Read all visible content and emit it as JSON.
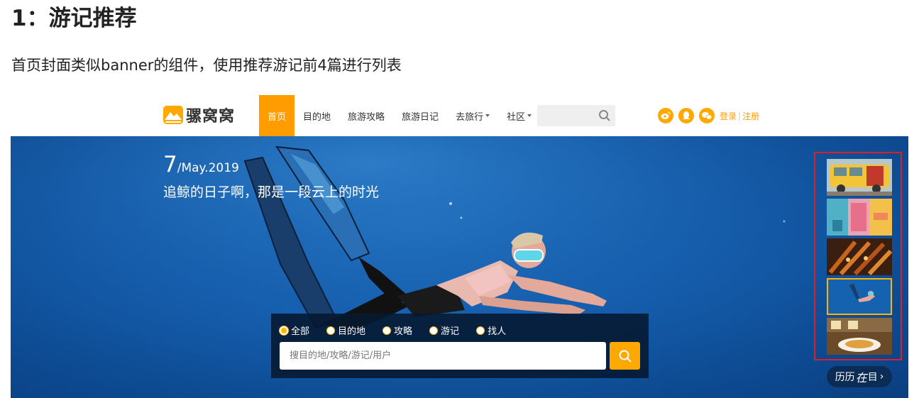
{
  "section": {
    "title": "1：游记推荐",
    "description": "首页封面类似banner的组件，使用推荐游记前4篇进行列表"
  },
  "header": {
    "logo_text": "骡窝窝",
    "nav": [
      {
        "label": "首页",
        "active": true
      },
      {
        "label": "目的地"
      },
      {
        "label": "旅游攻略"
      },
      {
        "label": "旅游日记"
      },
      {
        "label": "去旅行",
        "dropdown": true
      },
      {
        "label": "社区",
        "dropdown": true
      }
    ],
    "search_placeholder": "",
    "social_icons": [
      "weibo-icon",
      "qq-icon",
      "wechat-icon"
    ],
    "login_label": "登录",
    "separator": "|",
    "register_label": "注册",
    "accent_color": "#ff9d00"
  },
  "banner": {
    "day": "7",
    "date_rest": "/May.2019",
    "caption": "追鲸的日子啊，那是一段云上的时光",
    "thumbnails": [
      {
        "name": "thumb-yellow-van"
      },
      {
        "name": "thumb-colorful-street"
      },
      {
        "name": "thumb-skewers-food"
      },
      {
        "name": "thumb-diver",
        "active": true
      },
      {
        "name": "thumb-restaurant-meal"
      }
    ],
    "history_button": {
      "part1": "历历",
      "part2": "在",
      "part3": "目",
      "arrow": "›"
    }
  },
  "search_panel": {
    "options": [
      {
        "label": "全部",
        "checked": true
      },
      {
        "label": "目的地"
      },
      {
        "label": "攻略"
      },
      {
        "label": "游记"
      },
      {
        "label": "找人"
      }
    ],
    "input_placeholder": "搜目的地/攻略/游记/用户"
  }
}
